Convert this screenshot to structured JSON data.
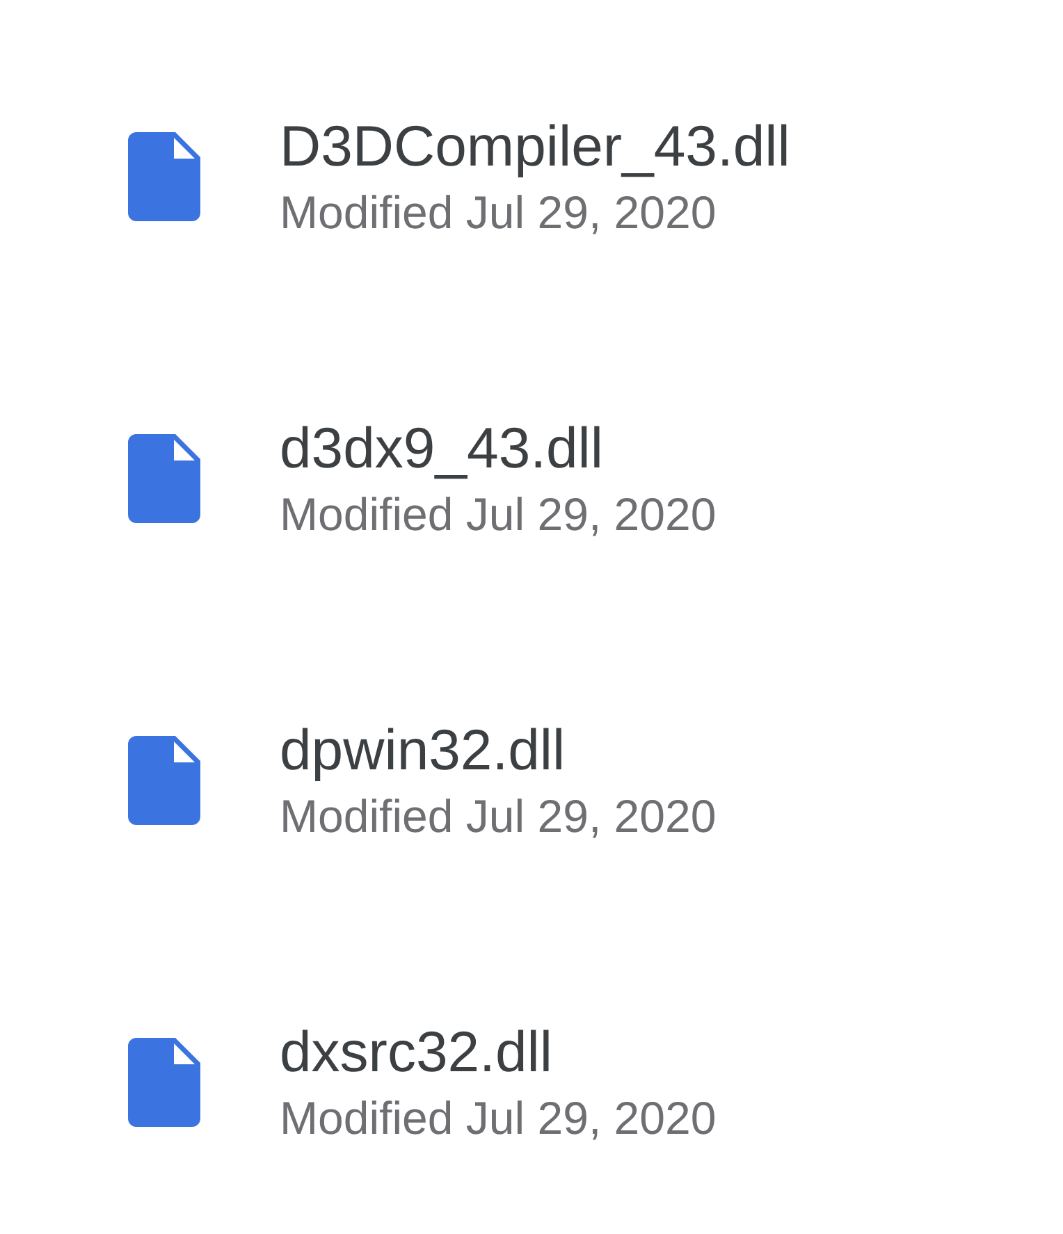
{
  "files": [
    {
      "name": "D3DCompiler_43.dll",
      "modified": "Modified Jul 29, 2020"
    },
    {
      "name": "d3dx9_43.dll",
      "modified": "Modified Jul 29, 2020"
    },
    {
      "name": "dpwin32.dll",
      "modified": "Modified Jul 29, 2020"
    },
    {
      "name": "dxsrc32.dll",
      "modified": "Modified Jul 29, 2020"
    }
  ]
}
